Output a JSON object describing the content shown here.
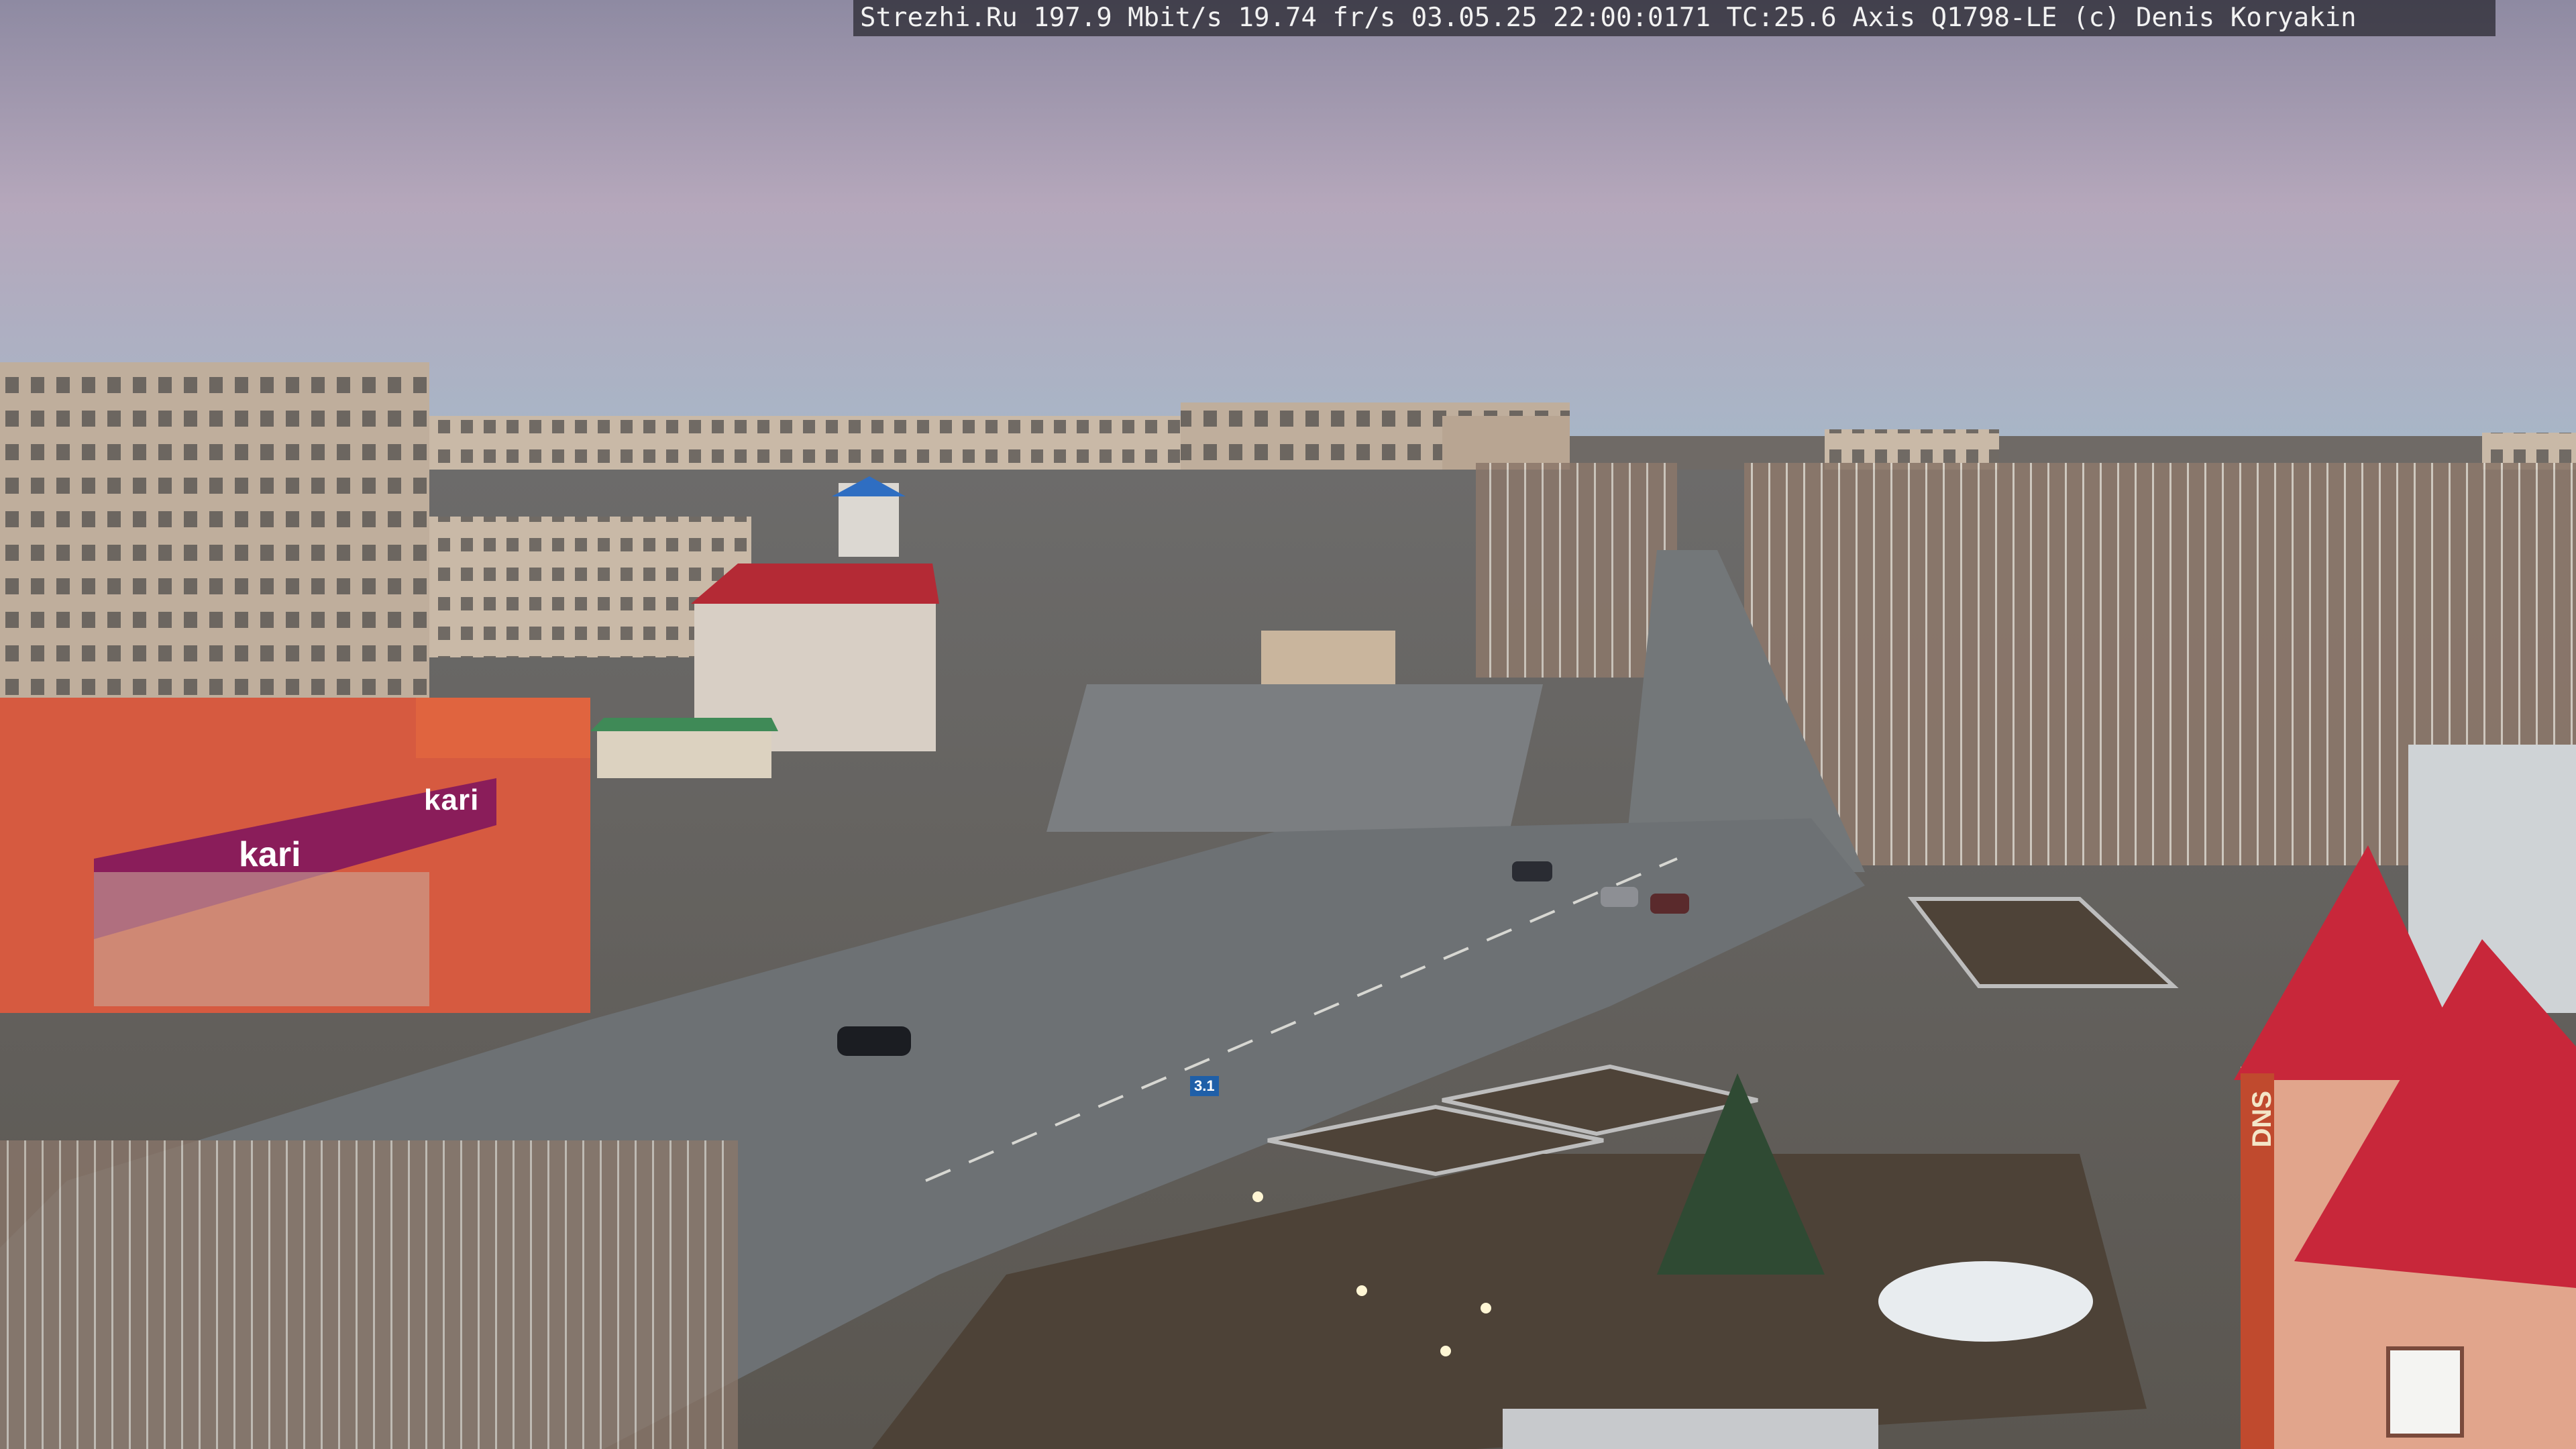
{
  "overlay": {
    "text": "Strezhi.Ru 197.9 Mbit/s 19.74 fr/s 03.05.25 22:00:0171 TC:25.6  Axis Q1798-LE  (c) Denis Koryakin"
  },
  "signs": {
    "kari_banner": "kari",
    "kari_store": "kari",
    "dns_store": "DNS",
    "road_sign": "3.1"
  },
  "colors": {
    "sky_top": "#8f8aa0",
    "sky_mid": "#b7a8ba",
    "sky_horizon": "#a9b8c8",
    "road": "#6e7377",
    "square": "#7a7d80",
    "building": "#bca996",
    "kari_red": "#d8553b",
    "kari_banner": "#8a1d5a",
    "dns_roof": "#c8273a",
    "dns_wall": "#e3a58d",
    "trees": "#8f7b6f",
    "lawn": "#4f4338"
  }
}
